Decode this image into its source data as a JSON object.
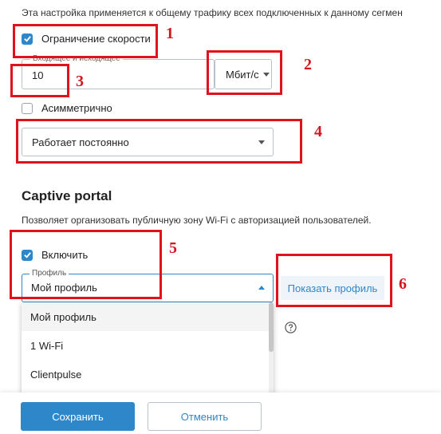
{
  "speed": {
    "description": "Эта настройка применяется к общему трафику всех подключенных к данному сегмен",
    "limit_label": "Ограничение скорости",
    "limit_checked": true,
    "inout_label": "Входящее и исходящее",
    "inout_value": "10",
    "unit_value": "Мбит/с",
    "asym_label": "Асимметрично",
    "asym_checked": false,
    "schedule_value": "Работает постоянно"
  },
  "captive": {
    "heading": "Captive portal",
    "description": "Позволяет организовать публичную зону Wi-Fi с авторизацией пользователей.",
    "enable_label": "Включить",
    "enable_checked": true,
    "profile_label": "Профиль",
    "profile_value": "Мой профиль",
    "show_profile": "Показать профиль",
    "dropdown_options": [
      "Мой профиль",
      "1 Wi-Fi",
      "Clientpulse"
    ]
  },
  "footer": {
    "save": "Сохранить",
    "cancel": "Отменить"
  },
  "annotations": [
    "1",
    "2",
    "3",
    "4",
    "5",
    "6"
  ],
  "colors": {
    "accent": "#2e87c8",
    "annotation_red": "#e0121b"
  },
  "icons": {
    "help": "question-circle-icon",
    "check": "checkmark-icon"
  }
}
